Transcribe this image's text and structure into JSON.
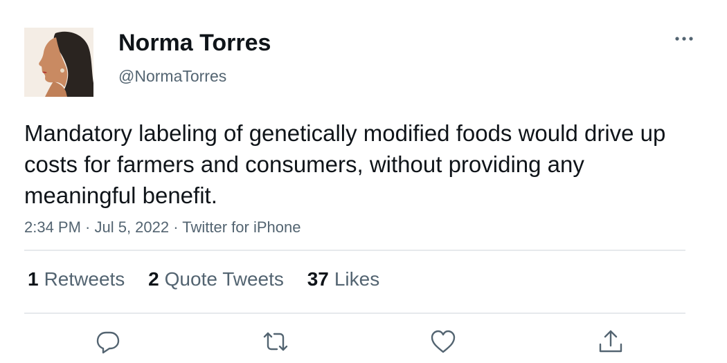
{
  "tweet": {
    "author": {
      "display_name": "Norma Torres",
      "handle": "@NormaTorres"
    },
    "text": "Mandatory labeling of genetically modified foods would drive up costs for farmers and consumers, without providing any meaningful benefit.",
    "meta": "2:34 PM · Jul 5, 2022 · Twitter for iPhone",
    "stats": {
      "retweets": {
        "count": "1",
        "label": "Retweets"
      },
      "quotes": {
        "count": "2",
        "label": "Quote Tweets"
      },
      "likes": {
        "count": "37",
        "label": "Likes"
      }
    }
  },
  "icons": {
    "more": "more-horizontal-icon",
    "reply": "reply-icon",
    "retweet": "retweet-icon",
    "like": "heart-icon",
    "share": "share-icon"
  },
  "colors": {
    "text_primary": "#0f1419",
    "text_secondary": "#536471",
    "divider": "#e6e9ec"
  }
}
